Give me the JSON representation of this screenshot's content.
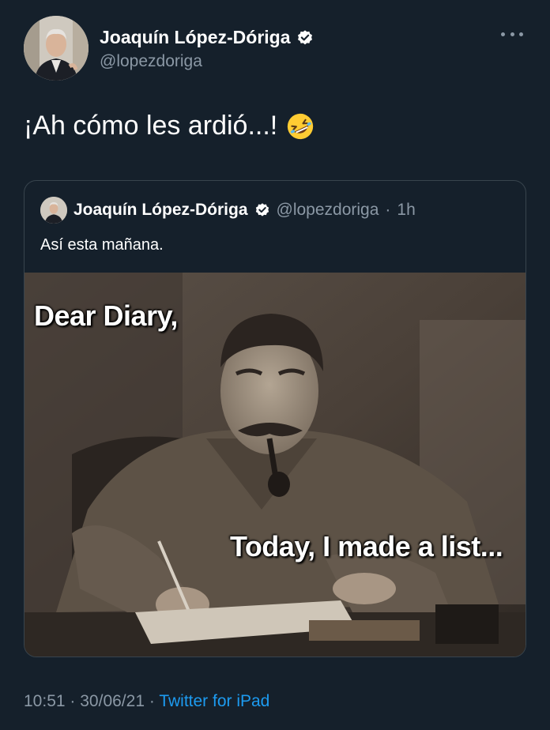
{
  "tweet": {
    "author": {
      "name": "Joaquín López-Dóriga",
      "handle": "@lopezdoriga",
      "verified": true
    },
    "text": "¡Ah cómo les ardió...!",
    "emoji": "rolling-on-the-floor-laughing-emoji",
    "quoted": {
      "name": "Joaquín López-Dóriga",
      "handle": "@lopezdoriga",
      "separator": "·",
      "age": "1h",
      "text": "Así esta mañana.",
      "image_caption_top": "Dear Diary,",
      "image_caption_bottom": "Today, I made a list..."
    },
    "time": "10:51",
    "separator": "·",
    "date": "30/06/21",
    "source": "Twitter for iPad"
  },
  "colors": {
    "background": "#15202b",
    "secondary_text": "#8b98a5",
    "link": "#1d9bf0",
    "border": "#38444d"
  }
}
